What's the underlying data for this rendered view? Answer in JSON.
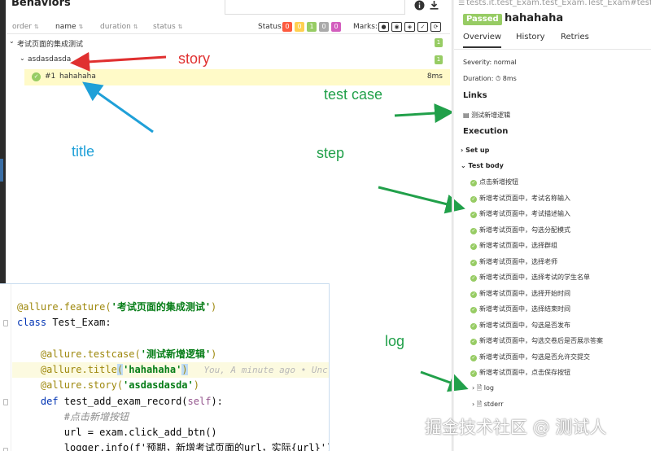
{
  "left_panel": {
    "title": "Behaviors",
    "columns": {
      "order": "order",
      "name": "name",
      "duration": "duration",
      "status": "status"
    },
    "status_label": "Status:",
    "status_counts": [
      "0",
      "0",
      "1",
      "0",
      "0"
    ],
    "marks_label": "Marks:",
    "tree": {
      "feature": "考试页面的集成测试",
      "feature_count": "1",
      "story": "asdasdasda",
      "story_count": "1",
      "test": {
        "number": "#1",
        "name": "hahahaha",
        "duration": "8ms"
      }
    }
  },
  "annotations": {
    "story": "story",
    "title": "title",
    "test_case": "test case",
    "step": "step",
    "log": "log"
  },
  "right_panel": {
    "breadcrumb": "tests.it.test_Exam.test_Exam.Test_Exam#test_add",
    "status_badge": "Passed",
    "case_title": "hahahaha",
    "tabs": [
      "Overview",
      "History",
      "Retries"
    ],
    "severity": "Severity: normal",
    "duration": "Duration: ⏱ 8ms",
    "links_heading": "Links",
    "link_text": "测试新增逻辑",
    "execution_heading": "Execution",
    "setup_label": "Set up",
    "test_body_label": "Test body",
    "steps": [
      "点击新增按钮",
      "新增考试页面中，考试名称输入",
      "新增考试页面中，考试描述输入",
      "新增考试页面中，勾选分配模式",
      "新增考试页面中，选择群组",
      "新增考试页面中，选择老师",
      "新增考试页面中，选择考试的学生名单",
      "新增考试页面中，选择开始时间",
      "新增考试页面中，选择结束时间",
      "新增考试页面中，勾选是否发布",
      "新增考试页面中，勾选交卷后是否展示答案",
      "新增考试页面中，勾选是否允许交提交",
      "新增考试页面中，点击保存按钮"
    ],
    "attachments": [
      "log",
      "stderr"
    ]
  },
  "code": {
    "line1_dec": "@allure.feature(",
    "line1_str": "'考试页面的集成测试'",
    "line1_end": ")",
    "line2_kw": "class",
    "line2_rest": " Test_Exam:",
    "line3_dec": "    @allure.testcase(",
    "line3_str": "'测试新增逻辑'",
    "line3_end": ")",
    "line4_dec": "    @allure.title",
    "line4_open": "(",
    "line4_str": "'hahahaha'",
    "line4_close": ")",
    "line4_ghost": "   You, A minute ago • Unc",
    "line5_dec": "    @allure.story(",
    "line5_str": "'asdasdasda'",
    "line5_end": ")",
    "line6_kw": "    def",
    "line6_rest": " test_add_exam_record(",
    "line6_self": "self",
    "line6_end": "):",
    "line7_cmt": "        #点击新增按钮",
    "line8": "        url = exam.click_add_btn()",
    "line9": "        logger.info(f'预期，新增考试页面的url，实际{url}')"
  },
  "watermark": "掘金技术社区 @ 测试人",
  "colors": {
    "passed": "#97cc64",
    "status_failed": "#fd5a3e",
    "status_broken": "#ffd050",
    "status_passed": "#97cc64",
    "status_skipped": "#aaaaaa",
    "status_unknown": "#d35ebe",
    "arrow_story": "#e03030",
    "arrow_title": "#1fa0d8",
    "annotation_green": "#21a04a"
  }
}
